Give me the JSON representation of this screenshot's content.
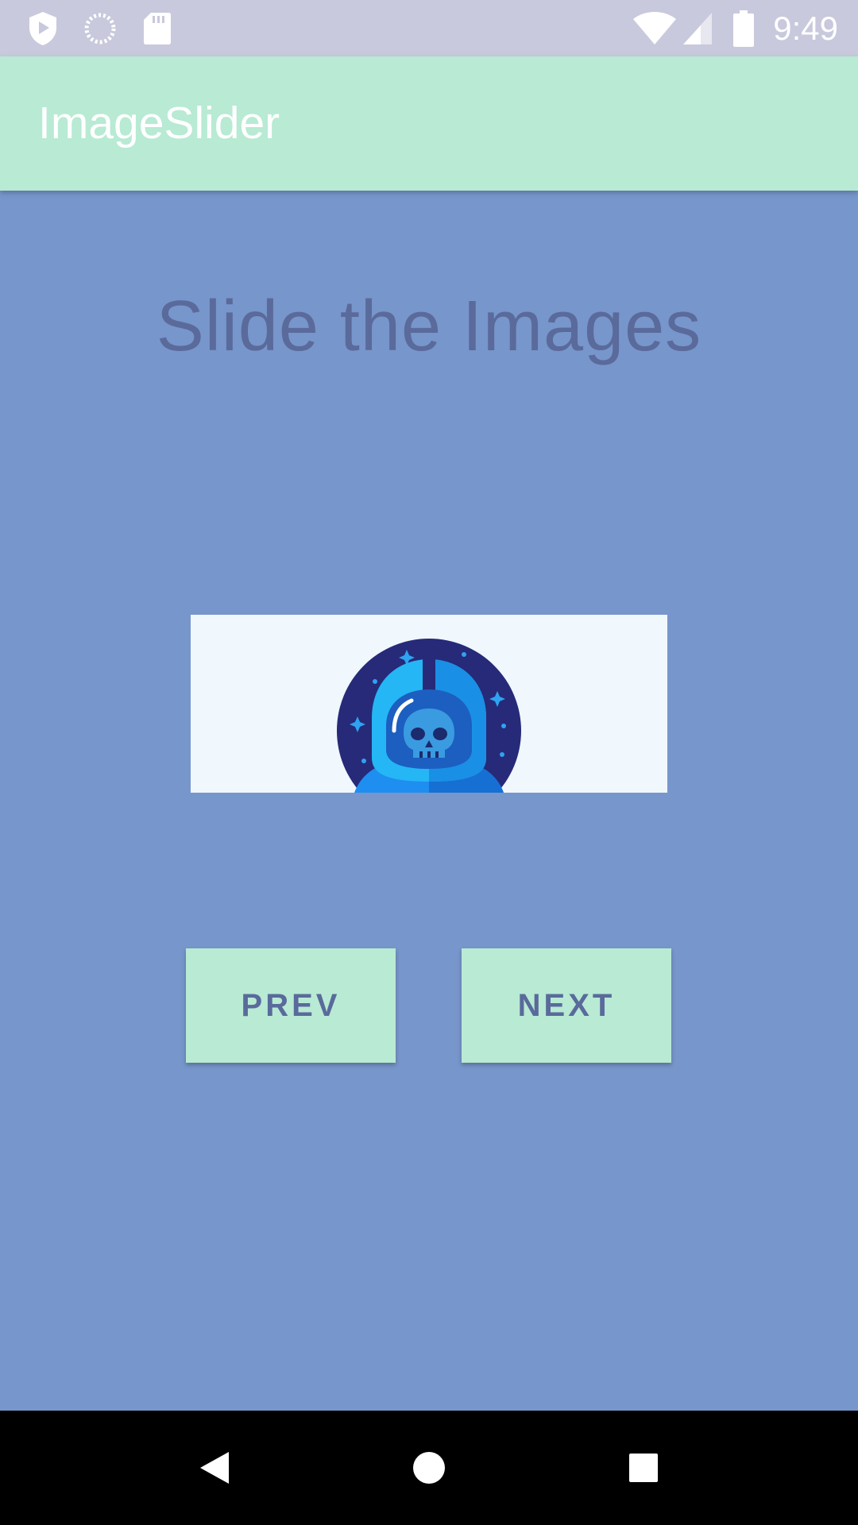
{
  "status_bar": {
    "time": "9:49",
    "left_icons": [
      "play-protect-icon",
      "sync-spinner-icon",
      "sd-card-icon"
    ],
    "right_icons": [
      "wifi-icon",
      "cell-signal-icon",
      "battery-icon"
    ]
  },
  "app_bar": {
    "title": "ImageSlider"
  },
  "main": {
    "heading": "Slide the Images",
    "slider": {
      "image": "astronaut-skull-icon"
    },
    "buttons": {
      "prev_label": "PREV",
      "next_label": "NEXT"
    }
  },
  "nav_bar": {
    "items": [
      "back-icon",
      "home-icon",
      "recents-icon"
    ]
  },
  "colors": {
    "background": "#7796cb",
    "app_bar": "#b8ead4",
    "status_bar": "#c8c9dc",
    "heading_text": "#5a6a9b",
    "button_bg": "#b8ead4",
    "image_bg": "#f0f7fd"
  }
}
